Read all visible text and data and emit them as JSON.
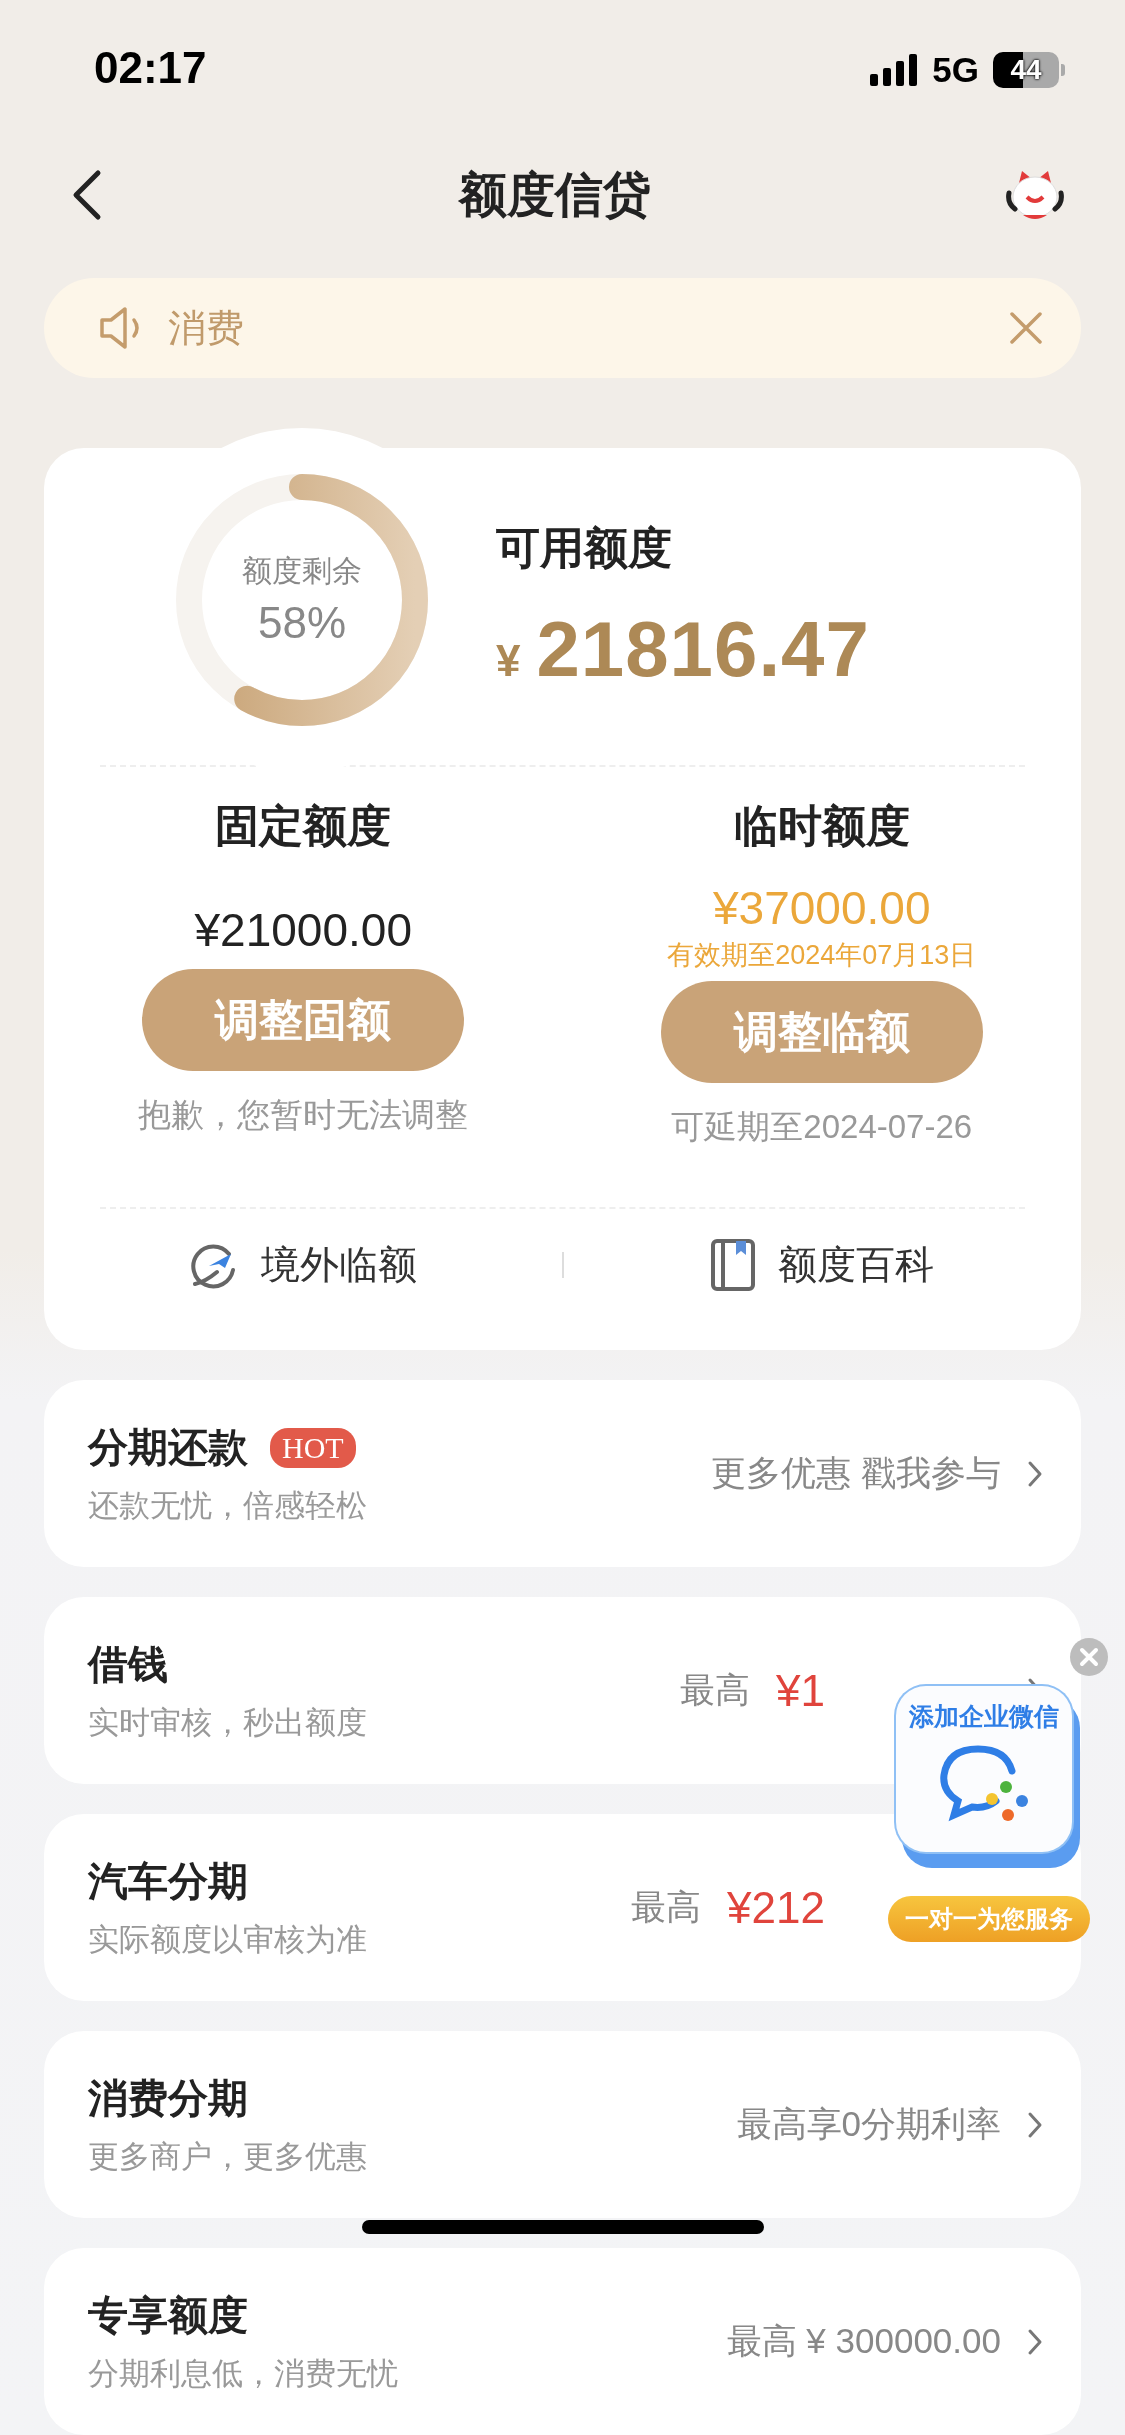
{
  "status_bar": {
    "time": "02:17",
    "network": "5G",
    "battery": "44"
  },
  "nav": {
    "title": "额度信贷"
  },
  "notice": {
    "text": "消费"
  },
  "summary": {
    "gauge_label": "额度剩余",
    "gauge_value": "58%",
    "level": 0.58,
    "title": "可用额度",
    "currency": "¥",
    "amount": "21816.47"
  },
  "quotas": [
    {
      "title": "固定额度",
      "amount": "¥21000.00",
      "highlight": false,
      "button": "调整固额",
      "note": "抱歉，您暂时无法调整"
    },
    {
      "title": "临时额度",
      "amount": "¥37000.00",
      "highlight": true,
      "validity": "有效期至2024年07月13日",
      "button": "调整临额",
      "note": "可延期至2024-07-26"
    }
  ],
  "links": [
    {
      "kind": "overseas",
      "label": "境外临额"
    },
    {
      "kind": "wiki",
      "label": "额度百科"
    }
  ],
  "products": [
    {
      "title": "分期还款",
      "badge": "HOT",
      "subtitle": "还款无忧，倍感轻松",
      "kind": "text",
      "text": "更多优惠 戳我参与",
      "arrow": true
    },
    {
      "title": "借钱",
      "subtitle": "实时审核，秒出额度",
      "kind": "amount",
      "prefix": "最高",
      "value": "¥1",
      "arrow": true
    },
    {
      "title": "汽车分期",
      "subtitle": "实际额度以审核为准",
      "kind": "amount",
      "prefix": "最高",
      "value": "¥212",
      "arrow": false
    },
    {
      "title": "消费分期",
      "subtitle": "更多商户，更多优惠",
      "kind": "text",
      "text": "最高享0分期利率",
      "arrow": true
    },
    {
      "title": "专享额度",
      "subtitle": "分期利息低，消费无忧",
      "kind": "text",
      "text": "最高 ¥ 300000.00",
      "arrow": true
    }
  ],
  "widget": {
    "title": "添加企业微信",
    "caption": "一对一为您服务"
  }
}
